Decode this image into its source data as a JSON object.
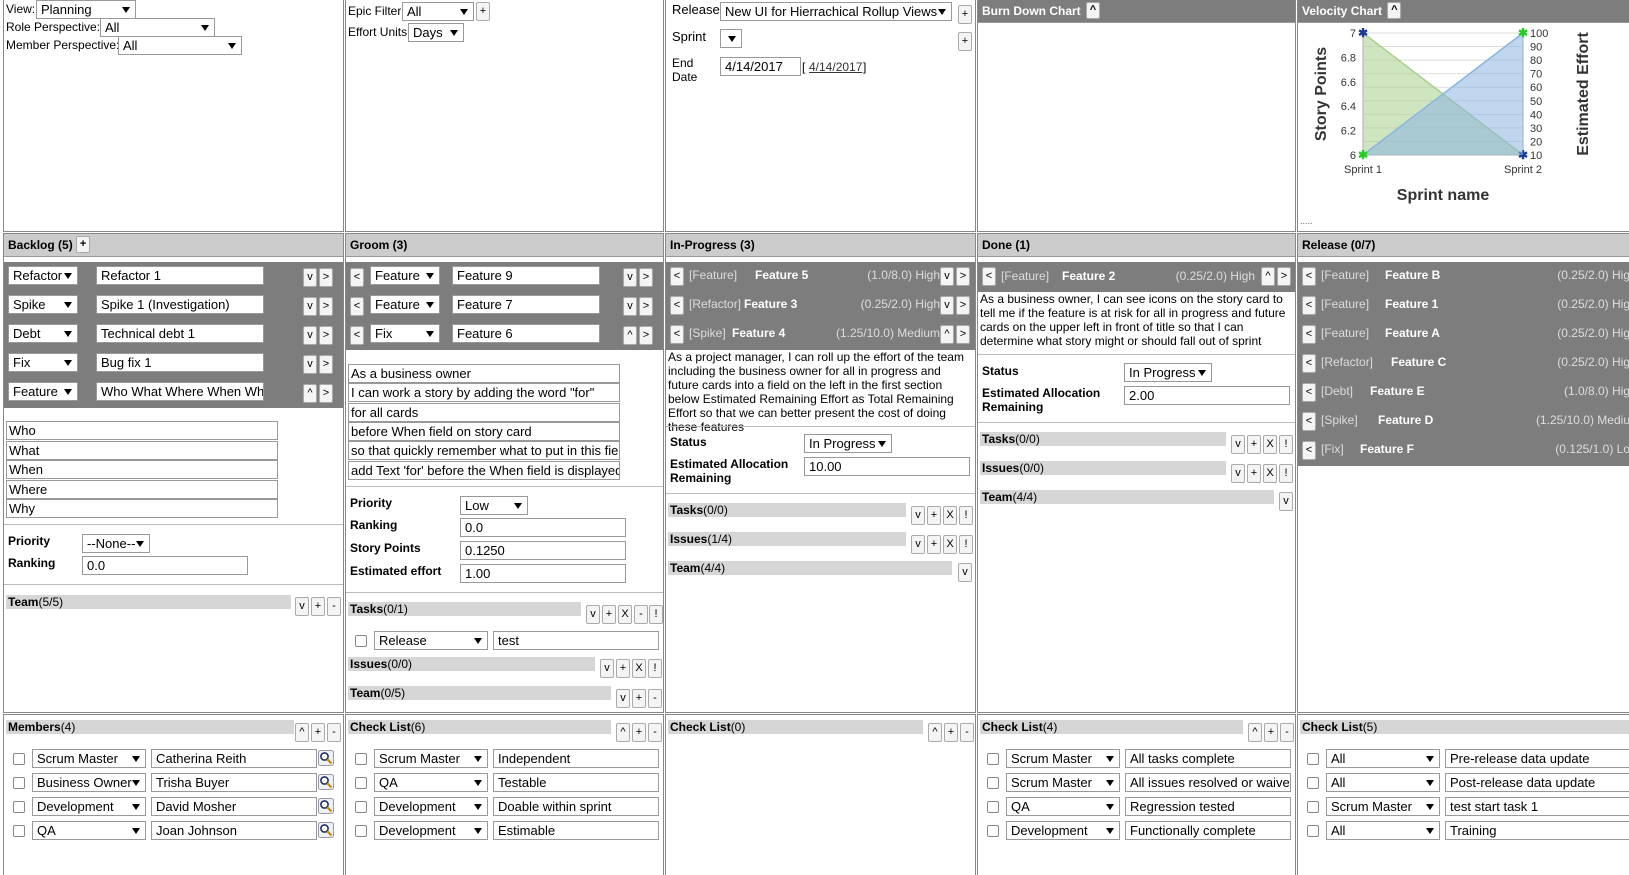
{
  "top": {
    "view_label": "View:",
    "view_value": "Planning",
    "role_label": "Role Perspective:",
    "role_value": "All",
    "member_label": "Member Perspective:",
    "member_value": "All",
    "epic_label": "Epic Filter:",
    "epic_value": "All",
    "effort_label": "Effort Units:",
    "effort_value": "Days",
    "plus": "+",
    "release_label": "Release",
    "release_value": "New UI for Hierrachical Rollup Views",
    "sprint_label": "Sprint",
    "sprint_value": "",
    "end_label": "End",
    "date_label": "Date",
    "end_value": "4/14/2017",
    "end_link": "4/14/2017",
    "bracket_open": "[",
    "bracket_close": "]",
    "burndown_title": "Burn Down Chart",
    "velocity_title": "Velocity Chart",
    "caret": "^",
    "dots": "....."
  },
  "chart_data": {
    "type": "line",
    "categories": [
      "Sprint 1",
      "Sprint 2"
    ],
    "xlabel": "Sprint name",
    "ylabel": "Story Points",
    "y2label": "Estimated Effort",
    "ylim": [
      6,
      7
    ],
    "y2lim": [
      10,
      100
    ],
    "yticks": [
      "7",
      "6.8",
      "6.6",
      "6.4",
      "6.2",
      "6"
    ],
    "y2ticks": [
      "100",
      "90",
      "80",
      "70",
      "60",
      "50",
      "40",
      "30",
      "20",
      "10"
    ],
    "series": [
      {
        "values": [
          7,
          6
        ],
        "color": "#a8d08d",
        "axis": "left"
      },
      {
        "values": [
          10,
          100
        ],
        "color": "#8ab4e0",
        "axis": "right"
      }
    ]
  },
  "backlog": {
    "title": "Backlog",
    "count": "(5)",
    "plus": "+",
    "items": [
      {
        "type": "Refactor",
        "name": "Refactor 1",
        "b1": "v",
        "b2": ">"
      },
      {
        "type": "Spike",
        "name": "Spike 1 (Investigation)",
        "b1": "v",
        "b2": ">"
      },
      {
        "type": "Debt",
        "name": "Technical debt 1",
        "b1": "v",
        "b2": ">"
      },
      {
        "type": "Fix",
        "name": "Bug fix 1",
        "b1": "v",
        "b2": ">"
      },
      {
        "type": "Feature",
        "name": "Who What Where When Why",
        "b1": "^",
        "b2": ">"
      }
    ],
    "fields": [
      "Who",
      "What",
      "When",
      "Where",
      "Why"
    ],
    "priority_label": "Priority",
    "priority_value": "--None--",
    "ranking_label": "Ranking",
    "ranking_value": "0.0",
    "team_label": "Team",
    "team_count": "(5/5)"
  },
  "groom": {
    "title": "Groom (3)",
    "items": [
      {
        "type": "Feature",
        "name": "Feature 9",
        "b0": "<",
        "b1": "v",
        "b2": ">"
      },
      {
        "type": "Feature",
        "name": "Feature 7",
        "b0": "<",
        "b1": "v",
        "b2": ">"
      },
      {
        "type": "Fix",
        "name": "Feature 6",
        "b0": "<",
        "b1": "^",
        "b2": ">"
      }
    ],
    "story": [
      "As a business owner",
      "I can work a story by adding the word \"for\"",
      "for all cards",
      "before When field on story card",
      "so that quickly remember what to put in this field",
      "add Text 'for' before the When field is displayed"
    ],
    "priority_label": "Priority",
    "priority_value": "Low",
    "ranking_label": "Ranking",
    "ranking_value": "0.0",
    "points_label": "Story Points",
    "points_value": "0.1250",
    "effort_label": "Estimated effort",
    "effort_value": "1.00",
    "tasks_label": "Tasks",
    "tasks_count": "(0/1)",
    "task_type": "Release",
    "task_name": "test",
    "issues_label": "Issues",
    "issues_count": "(0/0)",
    "team_label": "Team",
    "team_count": "(0/5)"
  },
  "inprogress": {
    "title": "In-Progress (3)",
    "items": [
      {
        "tag": "[Feature]",
        "name": "Feature 5",
        "meta": "(1.0/8.0) High",
        "b1": "v",
        "b2": ">"
      },
      {
        "tag": "[Refactor]",
        "name": "Feature 3",
        "meta": "(0.25/2.0) High",
        "b1": "v",
        "b2": ">"
      },
      {
        "tag": "[Spike]",
        "name": "Feature 4",
        "meta": "(1.25/10.0) Medium",
        "b1": "^",
        "b2": ">"
      }
    ],
    "description": "As a project manager, I can roll up the effort of the team including the business owner for all in progress and future cards into a field on the left in the first section below Estimated Remaining Effort as Total Remaining Effort so that we can better present the cost of doing these features",
    "status_label": "Status",
    "status_value": "In Progress",
    "alloc_label1": "Estimated Allocation",
    "alloc_label2": "Remaining",
    "alloc_value": "10.00",
    "tasks_label": "Tasks",
    "tasks_count": "(0/0)",
    "issues_label": "Issues",
    "issues_count": "(1/4)",
    "team_label": "Team",
    "team_count": "(4/4)"
  },
  "done": {
    "title": "Done (1)",
    "item": {
      "tag": "[Feature]",
      "name": "Feature 2",
      "meta": "(0.25/2.0) High"
    },
    "description": "As a business owner, I can see icons on the story card to tell me if the feature is at risk for all in progress and future cards on the upper left in front of title so that I can determine what story might or should fall out of sprint",
    "status_label": "Status",
    "status_value": "In Progress",
    "alloc_label1": "Estimated Allocation",
    "alloc_label2": "Remaining",
    "alloc_value": "2.00",
    "tasks_label": "Tasks",
    "tasks_count": "(0/0)",
    "issues_label": "Issues",
    "issues_count": "(0/0)",
    "team_label": "Team",
    "team_count": "(4/4)"
  },
  "release_col": {
    "title": "Release (0/7)",
    "items": [
      {
        "tag": "[Feature]",
        "name": "Feature B",
        "meta": "(0.25/2.0) Hig"
      },
      {
        "tag": "[Feature]",
        "name": "Feature 1",
        "meta": "(0.25/2.0) Hig"
      },
      {
        "tag": "[Feature]",
        "name": "Feature A",
        "meta": "(0.25/2.0) Hig"
      },
      {
        "tag": "[Refactor]",
        "name": "Feature C",
        "meta": "(0.25/2.0) Hig"
      },
      {
        "tag": "[Debt]",
        "name": "Feature E",
        "meta": "(1.0/8.0) Hig"
      },
      {
        "tag": "[Spike]",
        "name": "Feature D",
        "meta": "(1.25/10.0) Mediu"
      },
      {
        "tag": "[Fix]",
        "name": "Feature F",
        "meta": "(0.125/1.0) Lo"
      }
    ]
  },
  "members": {
    "title": "Members",
    "count": "(4)",
    "rows": [
      {
        "role": "Scrum Master",
        "name": "Catherina Reith"
      },
      {
        "role": "Business Owner",
        "name": "Trisha Buyer"
      },
      {
        "role": "Development",
        "name": "David Mosher"
      },
      {
        "role": "QA",
        "name": "Joan Johnson"
      }
    ]
  },
  "checklist_groom": {
    "title": "Check List",
    "count": "(6)",
    "rows": [
      {
        "role": "Scrum Master",
        "item": "Independent"
      },
      {
        "role": "QA",
        "item": "Testable"
      },
      {
        "role": "Development",
        "item": "Doable within sprint"
      },
      {
        "role": "Development",
        "item": "Estimable"
      }
    ]
  },
  "checklist_progress": {
    "title": "Check List",
    "count": "(0)"
  },
  "checklist_done": {
    "title": "Check List",
    "count": "(4)",
    "rows": [
      {
        "role": "Scrum Master",
        "item": "All tasks complete"
      },
      {
        "role": "Scrum Master",
        "item": "All issues resolved or waived"
      },
      {
        "role": "QA",
        "item": "Regression tested"
      },
      {
        "role": "Development",
        "item": "Functionally complete"
      }
    ]
  },
  "checklist_release": {
    "title": "Check List",
    "count": "(5)",
    "rows": [
      {
        "role": "All",
        "item": "Pre-release data update"
      },
      {
        "role": "All",
        "item": "Post-release data update"
      },
      {
        "role": "Scrum Master",
        "item": "test start task 1"
      },
      {
        "role": "All",
        "item": "Training"
      }
    ]
  },
  "btn": {
    "v": "v",
    "plus": "+",
    "x": "X",
    "minus": "-",
    "bang": "!",
    "up": "^",
    "lt": "<",
    "gt": ">"
  }
}
